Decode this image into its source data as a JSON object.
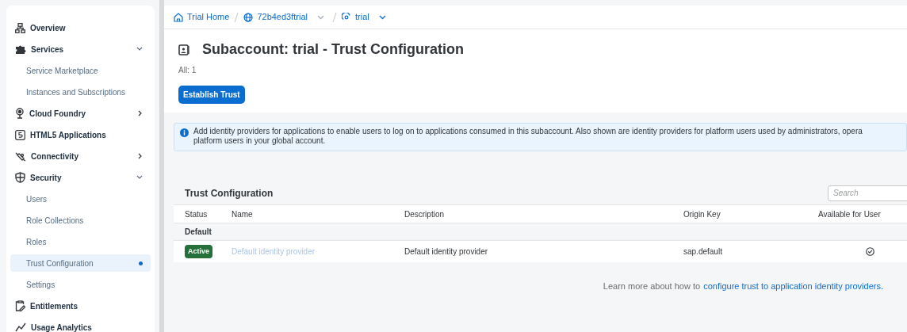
{
  "sidebar": {
    "items": [
      {
        "kind": "group",
        "label": "Overview",
        "selected": false
      },
      {
        "kind": "group",
        "label": "Services",
        "expanded": true,
        "selected": false
      },
      {
        "kind": "sub",
        "label": "Service Marketplace",
        "selected": false
      },
      {
        "kind": "sub",
        "label": "Instances and Subscriptions",
        "selected": false
      },
      {
        "kind": "group",
        "label": "Cloud Foundry",
        "expanded": false,
        "selected": false
      },
      {
        "kind": "group",
        "label": "HTML5 Applications",
        "selected": false
      },
      {
        "kind": "group",
        "label": "Connectivity",
        "expanded": false,
        "selected": false
      },
      {
        "kind": "group",
        "label": "Security",
        "expanded": true,
        "selected": false
      },
      {
        "kind": "sub",
        "label": "Users",
        "selected": false
      },
      {
        "kind": "sub",
        "label": "Role Collections",
        "selected": false
      },
      {
        "kind": "sub",
        "label": "Roles",
        "selected": false
      },
      {
        "kind": "sub",
        "label": "Trust Configuration",
        "selected": true
      },
      {
        "kind": "sub",
        "label": "Settings",
        "selected": false
      },
      {
        "kind": "group",
        "label": "Entitlements",
        "selected": false
      },
      {
        "kind": "group",
        "label": "Usage Analytics",
        "selected": false
      }
    ]
  },
  "breadcrumb": [
    {
      "label": "Trial Home",
      "dropdown": false
    },
    {
      "label": "72b4ed3ftrial",
      "dropdown": true
    },
    {
      "label": "trial",
      "dropdown": true
    }
  ],
  "page": {
    "title": "Subaccount: trial - Trust Configuration",
    "count": "All: 1",
    "action": "Establish Trust"
  },
  "info": {
    "lines": [
      "Add identity providers for applications to enable users to log on to applications consumed in this subaccount. Also shown are identity providers for platform users used by administrators, opera",
      "platform users in your global account."
    ]
  },
  "table": {
    "title": "Trust Configuration",
    "search": {
      "placeholder": "Search"
    },
    "columns": [
      "Status",
      "Name",
      "Description",
      "Origin Key",
      "Available for User"
    ],
    "groups": [
      {
        "label": "Default",
        "rows": [
          {
            "status": "Active",
            "name": "Default identity provider",
            "description": "Default identity provider",
            "origin_key": "sap.default",
            "available": true
          }
        ]
      }
    ]
  },
  "footer": {
    "text": "Learn more about how to",
    "link": "configure trust to application identity providers."
  }
}
